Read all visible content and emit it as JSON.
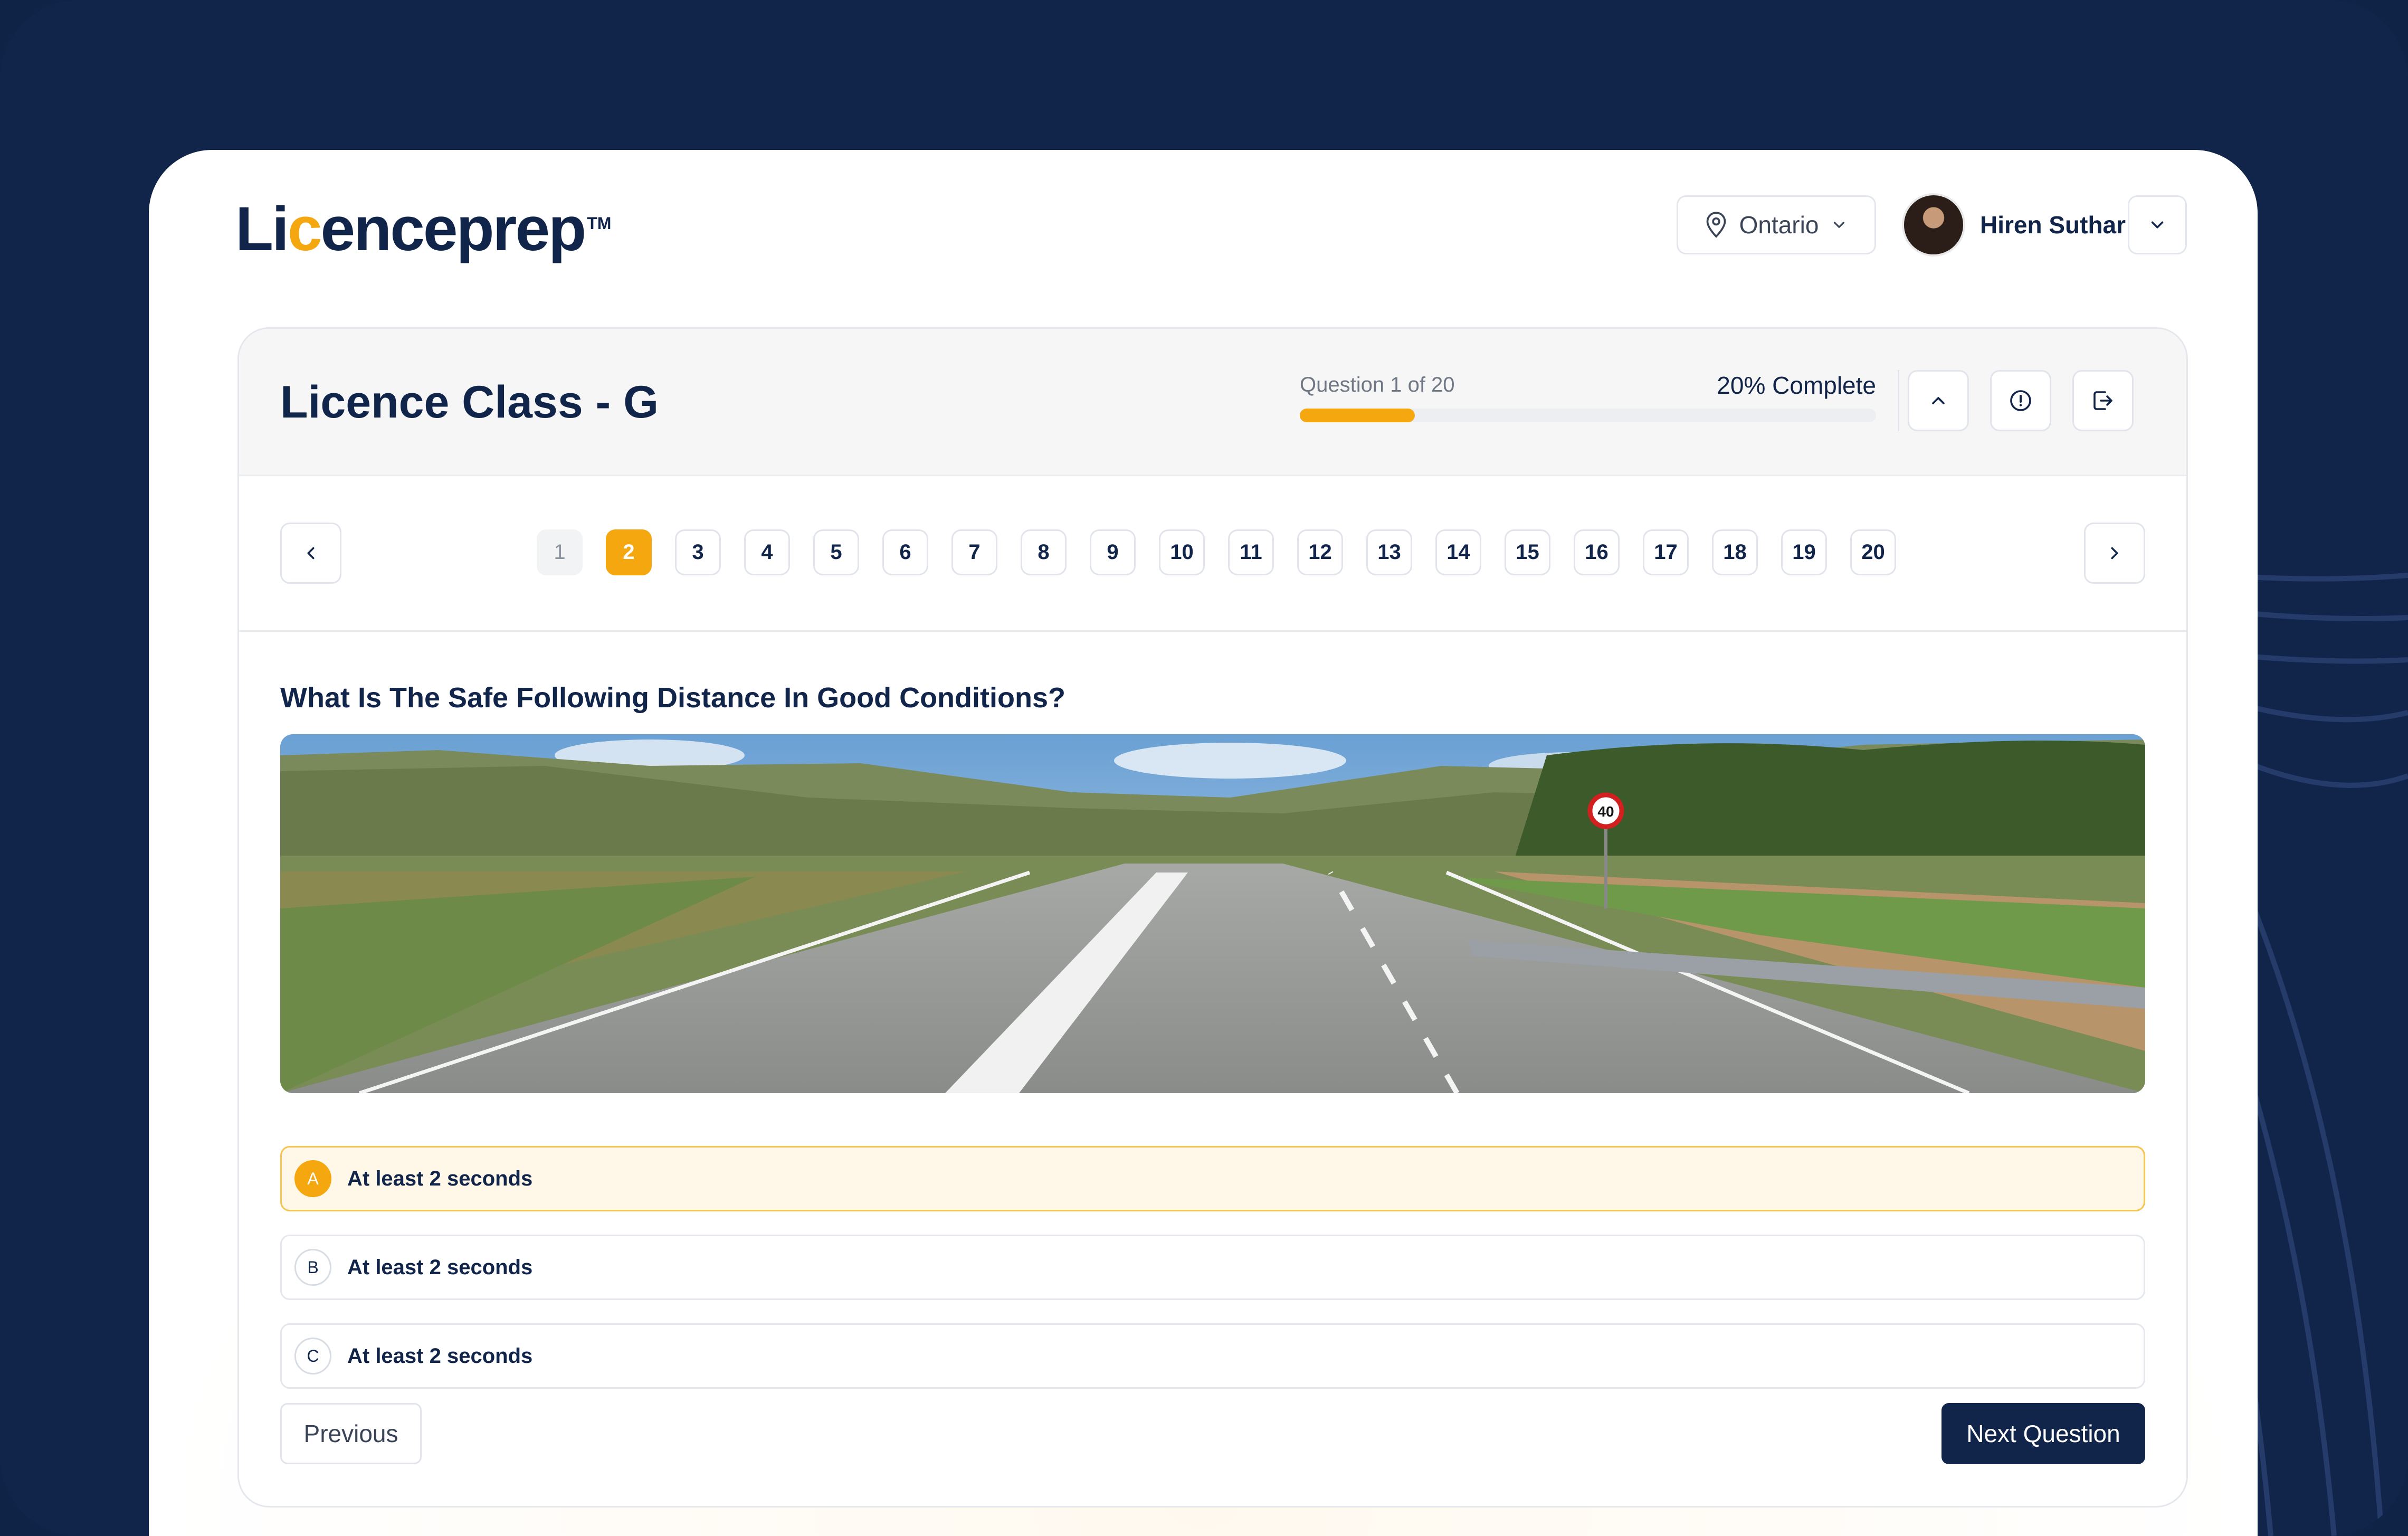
{
  "brand": {
    "logo_text_pre": "Li",
    "logo_text_ring": "c",
    "logo_text_post": "enceprep",
    "trademark": "TM"
  },
  "header": {
    "province": "Ontario",
    "user_name": "Hiren Suthar"
  },
  "quiz": {
    "title": "Licence Class - G",
    "progress_label": "Question 1 of 20",
    "progress_percent_label": "20% Complete",
    "progress_fraction": 0.2,
    "current_page": "2",
    "pages": [
      "1",
      "2",
      "3",
      "4",
      "5",
      "6",
      "7",
      "8",
      "9",
      "10",
      "11",
      "12",
      "13",
      "14",
      "15",
      "16",
      "17",
      "18",
      "19",
      "20"
    ],
    "question": "What Is The Safe Following Distance In Good Conditions?",
    "options": [
      {
        "letter": "A",
        "text": "At least 2 seconds",
        "selected": true
      },
      {
        "letter": "B",
        "text": "At least 2 seconds",
        "selected": false
      },
      {
        "letter": "C",
        "text": "At least 2 seconds",
        "selected": false
      }
    ],
    "sign_speed": "40",
    "previous_label": "Previous",
    "next_label": "Next Question"
  },
  "colors": {
    "navy": "#11244a",
    "accent": "#f5a70f",
    "selected_bg": "#fff8e8"
  },
  "icons": [
    "location-pin-icon",
    "chevron-down-icon",
    "chevron-up-icon",
    "info-icon",
    "exit-icon",
    "chevron-left-icon",
    "chevron-right-icon"
  ]
}
